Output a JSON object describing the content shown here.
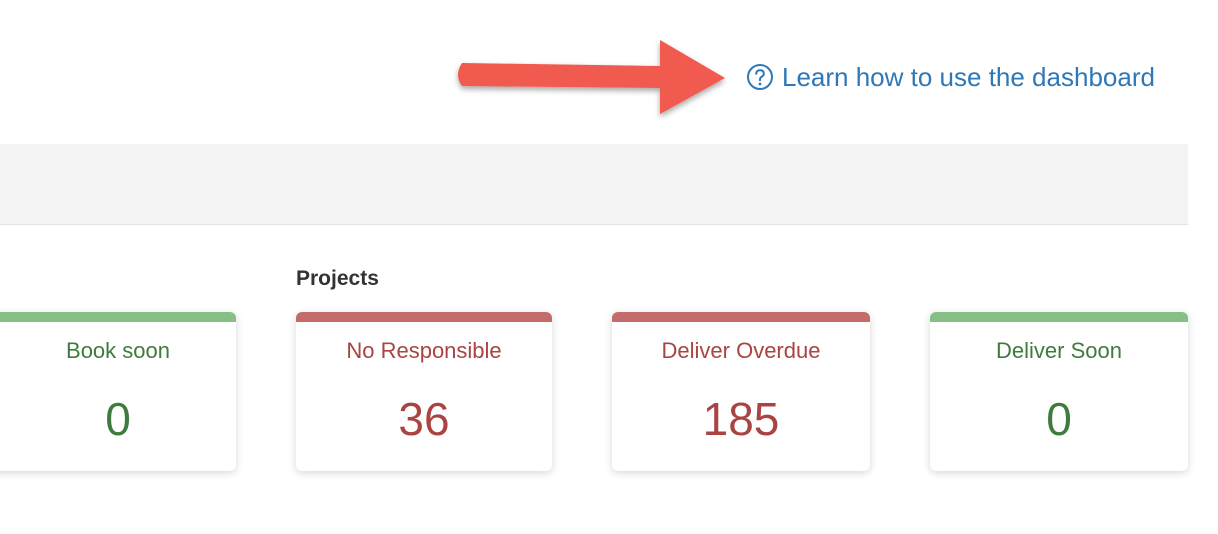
{
  "help_link": {
    "icon": "help-circle-icon",
    "label": "Learn how to use the dashboard",
    "color": "#2f78b7"
  },
  "annotation": {
    "icon": "arrow-right-icon",
    "color": "#f05a4f"
  },
  "projects": {
    "title": "Projects"
  },
  "cards": [
    {
      "label": "Book soon",
      "value": "0",
      "status": "green",
      "accent": "#86c087"
    },
    {
      "label": "No Responsible",
      "value": "36",
      "status": "red",
      "accent": "#c46c6c"
    },
    {
      "label": "Deliver Overdue",
      "value": "185",
      "status": "red",
      "accent": "#c46c6c"
    },
    {
      "label": "Deliver Soon",
      "value": "0",
      "status": "green",
      "accent": "#86c087"
    }
  ]
}
